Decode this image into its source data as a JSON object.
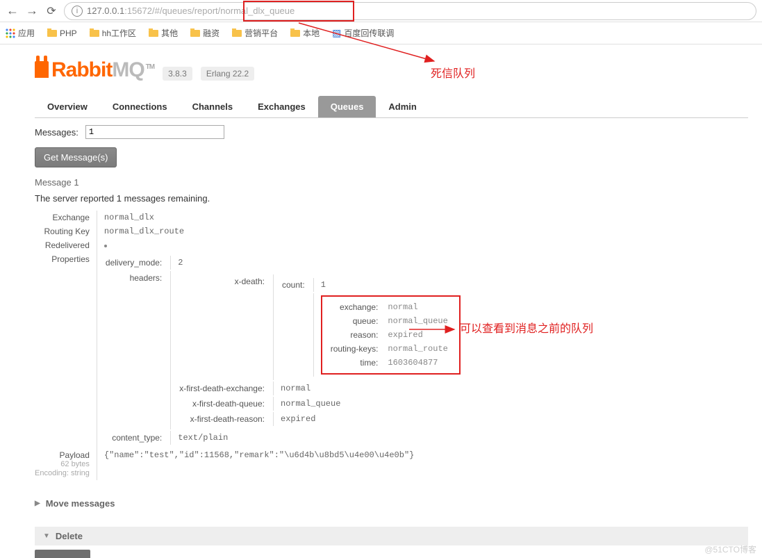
{
  "browser": {
    "url_host": "127.0.0.1",
    "url_port": ":15672",
    "url_path_prefix": "/#/queues/report/",
    "url_queue": "normal_dlx_queue"
  },
  "bookmarks": {
    "apps": "应用",
    "items": [
      "PHP",
      "hh工作区",
      "其他",
      "融资",
      "营销平台",
      "本地",
      "百度回传联调"
    ]
  },
  "header": {
    "brand_r": "Rabbit",
    "brand_mq": "MQ",
    "tm": "TM",
    "version": "3.8.3",
    "erlang": "Erlang 22.2"
  },
  "tabs": [
    "Overview",
    "Connections",
    "Channels",
    "Exchanges",
    "Queues",
    "Admin"
  ],
  "active_tab": "Queues",
  "form": {
    "messages_label": "Messages:",
    "messages_value": "1",
    "get_btn": "Get Message(s)"
  },
  "message": {
    "heading": "Message 1",
    "remaining_pre": "The server reported ",
    "remaining_count": "1",
    "remaining_post": " messages remaining.",
    "labels": {
      "exchange": "Exchange",
      "routing_key": "Routing Key",
      "redelivered": "Redelivered",
      "properties": "Properties",
      "payload": "Payload"
    },
    "exchange": "normal_dlx",
    "routing_key": "normal_dlx_route",
    "props": {
      "delivery_mode_k": "delivery_mode:",
      "delivery_mode_v": "2",
      "headers_k": "headers:",
      "xdeath_k": "x-death:",
      "count_k": "count:",
      "count_v": "1",
      "xdeath": {
        "exchange_k": "exchange:",
        "exchange_v": "normal",
        "queue_k": "queue:",
        "queue_v": "normal_queue",
        "reason_k": "reason:",
        "reason_v": "expired",
        "rk_k": "routing-keys:",
        "rk_v": "normal_route",
        "time_k": "time:",
        "time_v": "1603604877"
      },
      "xfde_k": "x-first-death-exchange:",
      "xfde_v": "normal",
      "xfdq_k": "x-first-death-queue:",
      "xfdq_v": "normal_queue",
      "xfdr_k": "x-first-death-reason:",
      "xfdr_v": "expired",
      "ct_k": "content_type:",
      "ct_v": "text/plain"
    },
    "payload_bytes": "62 bytes",
    "payload_encoding": "Encoding: string",
    "payload_body": "{\"name\":\"test\",\"id\":11568,\"remark\":\"\\u6d4b\\u8bd5\\u4e00\\u4e0b\"}"
  },
  "sections": {
    "move": "Move messages",
    "delete": "Delete"
  },
  "annotations": {
    "top": "死信队列",
    "mid": "可以查看到消息之前的队列"
  },
  "watermark": "@51CTO博客"
}
